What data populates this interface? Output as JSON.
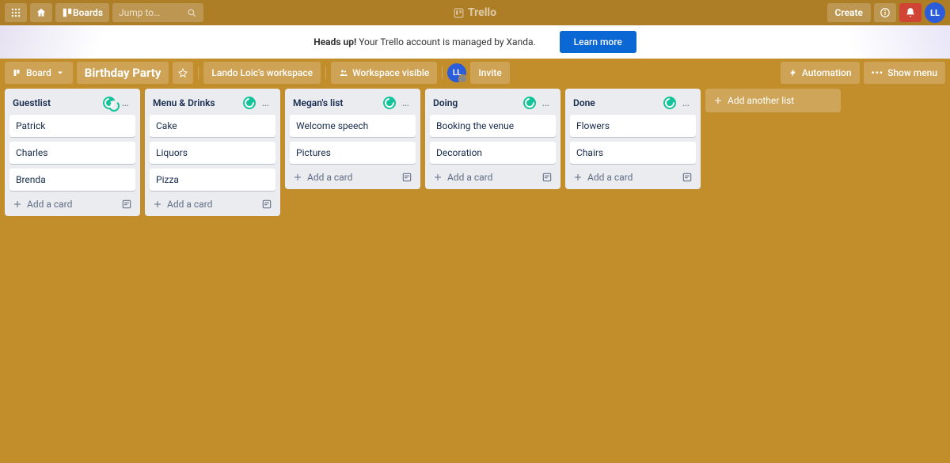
{
  "app": {
    "name": "Trello"
  },
  "header": {
    "boards_label": "Boards",
    "search_placeholder": "Jump to…",
    "create_label": "Create",
    "avatar_initials": "LL"
  },
  "banner": {
    "strong": "Heads up!",
    "text": " Your Trello account is managed by Xanda.",
    "learn_more": "Learn more"
  },
  "board_header": {
    "board_switch": "Board",
    "title": "Birthday Party",
    "workspace": "Lando Loic's workspace",
    "visibility": "Workspace visible",
    "member_initials": "LL",
    "invite": "Invite",
    "automation": "Automation",
    "show_menu": "Show menu"
  },
  "lists": [
    {
      "title": "Guestlist",
      "cards": [
        "Patrick",
        "Charles",
        "Brenda"
      ],
      "loading": true
    },
    {
      "title": "Menu & Drinks",
      "cards": [
        "Cake",
        "Liquors",
        "Pizza"
      ],
      "loading": false
    },
    {
      "title": "Megan's list",
      "cards": [
        "Welcome speech",
        "Pictures"
      ],
      "loading": false
    },
    {
      "title": "Doing",
      "cards": [
        "Booking the venue",
        "Decoration"
      ],
      "loading": false
    },
    {
      "title": "Done",
      "cards": [
        "Flowers",
        "Chairs"
      ],
      "loading": false
    }
  ],
  "list_footer": {
    "add_card": "Add a card"
  },
  "add_list": "Add another list"
}
